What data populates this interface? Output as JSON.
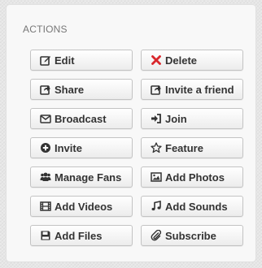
{
  "section": {
    "title": "ACTIONS"
  },
  "colors": {
    "delete_icon": "#d9262b",
    "icon": "#333333"
  },
  "actions": [
    {
      "label": "Edit",
      "icon": "edit-icon"
    },
    {
      "label": "Delete",
      "icon": "x-icon"
    },
    {
      "label": "Share",
      "icon": "share-icon"
    },
    {
      "label": "Invite a friend",
      "icon": "invite-friend-icon"
    },
    {
      "label": "Broadcast",
      "icon": "envelope-icon"
    },
    {
      "label": "Join",
      "icon": "sign-in-icon"
    },
    {
      "label": "Invite",
      "icon": "plus-circle-icon"
    },
    {
      "label": "Feature",
      "icon": "star-outline-icon"
    },
    {
      "label": "Manage Fans",
      "icon": "users-icon"
    },
    {
      "label": "Add Photos",
      "icon": "picture-icon"
    },
    {
      "label": "Add Videos",
      "icon": "film-icon"
    },
    {
      "label": "Add Sounds",
      "icon": "music-icon"
    },
    {
      "label": "Add Files",
      "icon": "floppy-disk-icon"
    },
    {
      "label": "Subscribe",
      "icon": "paperclip-icon"
    }
  ]
}
